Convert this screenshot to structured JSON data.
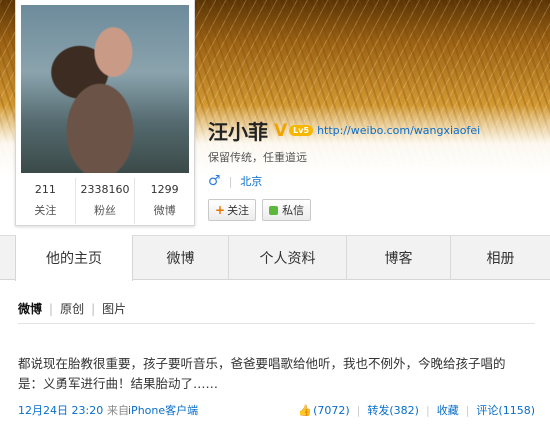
{
  "profile": {
    "name": "汪小菲",
    "verified_mark": "V",
    "level": "Lv5",
    "homepage_url": "http://weibo.com/wangxiaofei",
    "bio": "保留传统，任重道远",
    "gender_symbol": "♂",
    "location": "北京",
    "stats": [
      {
        "value": "211",
        "label": "关注"
      },
      {
        "value": "2338160",
        "label": "粉丝"
      },
      {
        "value": "1299",
        "label": "微博"
      }
    ],
    "follow_label": "关注",
    "message_label": "私信"
  },
  "tabs": [
    {
      "label": "他的主页",
      "active": true
    },
    {
      "label": "微博",
      "active": false
    },
    {
      "label": "个人资料",
      "active": false
    },
    {
      "label": "博客",
      "active": false
    },
    {
      "label": "相册",
      "active": false
    }
  ],
  "subnav": [
    "微博",
    "原创",
    "图片"
  ],
  "post": {
    "line1": "都说现在胎教很重要，孩子要听音乐，爸爸要唱歌给他听，我也不例外，今晚给孩子唱的",
    "line2": "是：义勇军进行曲！结果胎动了……",
    "timestamp": "12月24日 23:20",
    "source_prefix": "来自",
    "source_client": "iPhone客户端",
    "likes": "(7072)",
    "repost": "转发(382)",
    "favorite": "收藏",
    "comment": "评论(1158)"
  },
  "colors": {
    "link": "#0a6ec9",
    "verified": "#f2a400",
    "follow_plus": "#e67300"
  }
}
